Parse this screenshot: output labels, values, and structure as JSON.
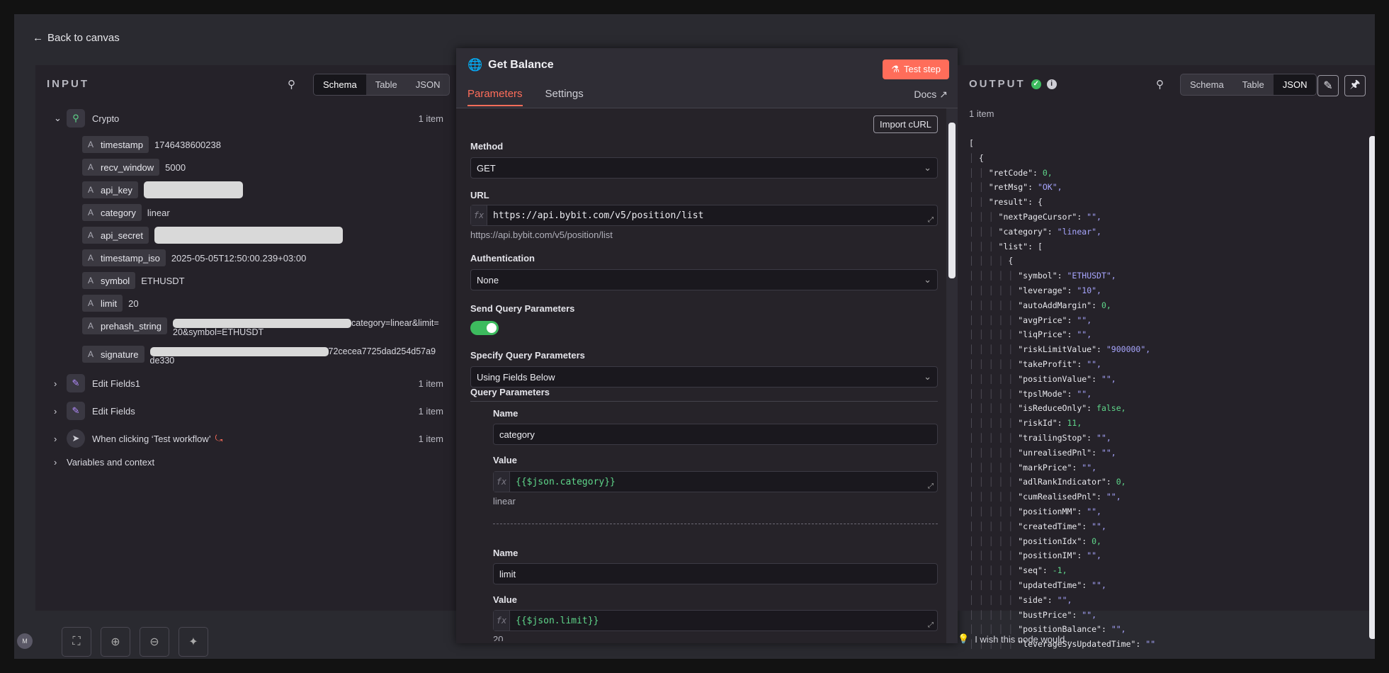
{
  "back_label": "Back to canvas",
  "input": {
    "title": "INPUT",
    "tabs": [
      "Schema",
      "Table",
      "JSON"
    ],
    "active_tab": "Schema",
    "nodes": [
      {
        "name": "Crypto",
        "count": "1 item"
      },
      {
        "name": "Edit Fields1",
        "count": "1 item"
      },
      {
        "name": "Edit Fields",
        "count": "1 item"
      },
      {
        "name": "When clicking ‘Test workflow’",
        "count": "1 item"
      }
    ],
    "fields": [
      {
        "key": "timestamp",
        "value": "1746438600238"
      },
      {
        "key": "recv_window",
        "value": "5000"
      },
      {
        "key": "api_key",
        "value": ""
      },
      {
        "key": "category",
        "value": "linear"
      },
      {
        "key": "api_secret",
        "value": ""
      },
      {
        "key": "timestamp_iso",
        "value": "2025-05-05T12:50:00.239+03:00"
      },
      {
        "key": "symbol",
        "value": "ETHUSDT"
      },
      {
        "key": "limit",
        "value": "20"
      },
      {
        "key": "prehash_string",
        "value": "category=linear&limit=",
        "value2": "20&symbol=ETHUSDT"
      },
      {
        "key": "signature",
        "value": "72cecea7725dad254d57a9",
        "value2": "de330"
      }
    ],
    "type_letter": "A",
    "variables_label": "Variables and context"
  },
  "node": {
    "title": "Get Balance",
    "test_button": "Test step",
    "tabs": [
      "Parameters",
      "Settings"
    ],
    "active_tab": "Parameters",
    "docs": "Docs",
    "import_curl": "Import cURL",
    "method_label": "Method",
    "method_value": "GET",
    "url_label": "URL",
    "url_value": "https://api.bybit.com/v5/position/list",
    "url_hint": "https://api.bybit.com/v5/position/list",
    "auth_label": "Authentication",
    "auth_value": "None",
    "send_query_label": "Send Query Parameters",
    "specify_label": "Specify Query Parameters",
    "specify_value": "Using Fields Below",
    "query_params_label": "Query Parameters",
    "fx": "fx",
    "params": [
      {
        "name_label": "Name",
        "name": "category",
        "value_label": "Value",
        "value": "{{$json.category}}",
        "hint": "linear"
      },
      {
        "name_label": "Name",
        "name": "limit",
        "value_label": "Value",
        "value": "{{$json.limit}}",
        "hint": "20"
      }
    ]
  },
  "output": {
    "title": "OUTPUT",
    "tabs": [
      "Schema",
      "Table",
      "JSON"
    ],
    "active_tab": "JSON",
    "count": "1 item",
    "wish": "I wish this node would...",
    "json_lines": [
      {
        "indent": 0,
        "text": "["
      },
      {
        "indent": 1,
        "text": "{"
      },
      {
        "indent": 2,
        "key": "\"retCode\"",
        "num": "0"
      },
      {
        "indent": 2,
        "key": "\"retMsg\"",
        "str": "\"OK\""
      },
      {
        "indent": 2,
        "key": "\"result\"",
        "raw": "{"
      },
      {
        "indent": 3,
        "key": "\"nextPageCursor\"",
        "str": "\"\""
      },
      {
        "indent": 3,
        "key": "\"category\"",
        "str": "\"linear\""
      },
      {
        "indent": 3,
        "key": "\"list\"",
        "raw": "["
      },
      {
        "indent": 4,
        "text": "{"
      },
      {
        "indent": 5,
        "key": "\"symbol\"",
        "str": "\"ETHUSDT\""
      },
      {
        "indent": 5,
        "key": "\"leverage\"",
        "str": "\"10\""
      },
      {
        "indent": 5,
        "key": "\"autoAddMargin\"",
        "num": "0"
      },
      {
        "indent": 5,
        "key": "\"avgPrice\"",
        "str": "\"\""
      },
      {
        "indent": 5,
        "key": "\"liqPrice\"",
        "str": "\"\""
      },
      {
        "indent": 5,
        "key": "\"riskLimitValue\"",
        "str": "\"900000\""
      },
      {
        "indent": 5,
        "key": "\"takeProfit\"",
        "str": "\"\""
      },
      {
        "indent": 5,
        "key": "\"positionValue\"",
        "str": "\"\""
      },
      {
        "indent": 5,
        "key": "\"tpslMode\"",
        "str": "\"\""
      },
      {
        "indent": 5,
        "key": "\"isReduceOnly\"",
        "num": "false"
      },
      {
        "indent": 5,
        "key": "\"riskId\"",
        "num": "11"
      },
      {
        "indent": 5,
        "key": "\"trailingStop\"",
        "str": "\"\""
      },
      {
        "indent": 5,
        "key": "\"unrealisedPnl\"",
        "str": "\"\""
      },
      {
        "indent": 5,
        "key": "\"markPrice\"",
        "str": "\"\""
      },
      {
        "indent": 5,
        "key": "\"adlRankIndicator\"",
        "num": "0"
      },
      {
        "indent": 5,
        "key": "\"cumRealisedPnl\"",
        "str": "\"\""
      },
      {
        "indent": 5,
        "key": "\"positionMM\"",
        "str": "\"\""
      },
      {
        "indent": 5,
        "key": "\"createdTime\"",
        "str": "\"\""
      },
      {
        "indent": 5,
        "key": "\"positionIdx\"",
        "num": "0"
      },
      {
        "indent": 5,
        "key": "\"positionIM\"",
        "str": "\"\""
      },
      {
        "indent": 5,
        "key": "\"seq\"",
        "num": "-1"
      },
      {
        "indent": 5,
        "key": "\"updatedTime\"",
        "str": "\"\""
      },
      {
        "indent": 5,
        "key": "\"side\"",
        "str": "\"\""
      },
      {
        "indent": 5,
        "key": "\"bustPrice\"",
        "str": "\"\""
      },
      {
        "indent": 5,
        "key": "\"positionBalance\"",
        "str": "\"\""
      },
      {
        "indent": 5,
        "key": "\"leverageSysUpdatedTime\"",
        "str": "\"\""
      }
    ]
  },
  "colors": {
    "accent": "#ff6d5a",
    "toggle": "#3dbb5e",
    "bg": "#252229"
  }
}
